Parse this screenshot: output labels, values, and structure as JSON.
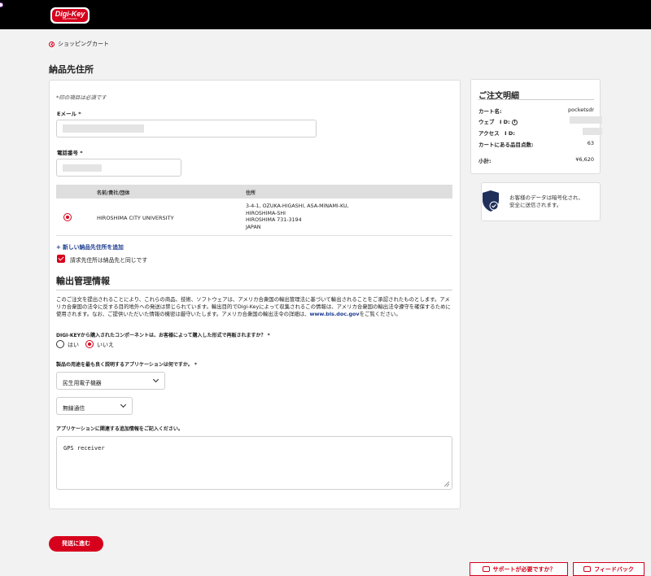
{
  "brand": {
    "logo_text": "Digi-Key",
    "logo_sub": "ELECTRONICS",
    "accent": "#d6001c",
    "link_color": "#1a3a8f"
  },
  "nav": {
    "back_label": "ショッピングカート"
  },
  "page": {
    "title": "納品先住所"
  },
  "form": {
    "required_note": "*印の項目は必須です",
    "email_label": "Eメール *",
    "phone_label": "電話番号 *",
    "address_table": {
      "headers": [
        "名前/貴社/団体",
        "住所"
      ],
      "rows": [
        {
          "selected": true,
          "name": "HIROSHIMA CITY UNIVERSITY",
          "address_lines": [
            "3-4-1, OZUKA-HIGASHI, ASA-MINAMI-KU,",
            "HIROSHIMA-SHI",
            "HIROSHIMA 731-3194",
            "JAPAN"
          ]
        }
      ]
    },
    "add_address_link": "+ 新しい納品先住所を追加",
    "billing_same_label": "請求先住所は納品先と同じです",
    "billing_same_checked": true
  },
  "export": {
    "title": "輸出管理情報",
    "paragraph": "このご注文を提出されることにより、これらの商品、技術、ソフトウェアは、アメリカ合衆国の輸出管理法に基づいて輸出されることをご承認されたものとします。アメリカ合衆国の法令に反する目的地外への発送は禁じられています。輸出目的でDigi-Keyによって収集されるこの情報は、アメリカ合衆国の輸出法令遵守を確保するために使用されます。なお、ご提供いただいた情報の機密は厳守いたします。アメリカ合衆国の輸出法令の詳細は、",
    "link_text": "www.bis.doc.gov",
    "paragraph_end": "をご覧ください。",
    "resell_question": "DIGI-KEYから購入されたコンポーネントは、お客様によって購入した形式で再販されますか？ *",
    "yes_label": "はい",
    "no_label": "いいえ",
    "selected": "no",
    "application_question": "製品の用途を最も良く説明するアプリケーションは何ですか。 *",
    "application_value": "民生用電子機器",
    "sub_application_value": "無線通信",
    "additional_info_label": "アプリケーションに関連する追加情報をご記入ください。",
    "additional_info_value": "GPS receiver"
  },
  "submit_label": "発送に進む",
  "summary": {
    "title": "ご注文明細",
    "cart_name_label": "カート名:",
    "cart_name_value": "pocketsdr",
    "web_id_label": "ウェブ　I D:",
    "access_id_label": "アクセス　I D:",
    "item_count_label": "カートにある品目点数:",
    "item_count_value": "63",
    "subtotal_label": "小計:",
    "subtotal_value": "¥6,620"
  },
  "secure": {
    "line1": "お客様のデータは暗号化され、",
    "line2": "安全に送信されます。"
  },
  "footer": {
    "support_label": "サポートが必要ですか？",
    "feedback_label": "フィードバック"
  }
}
